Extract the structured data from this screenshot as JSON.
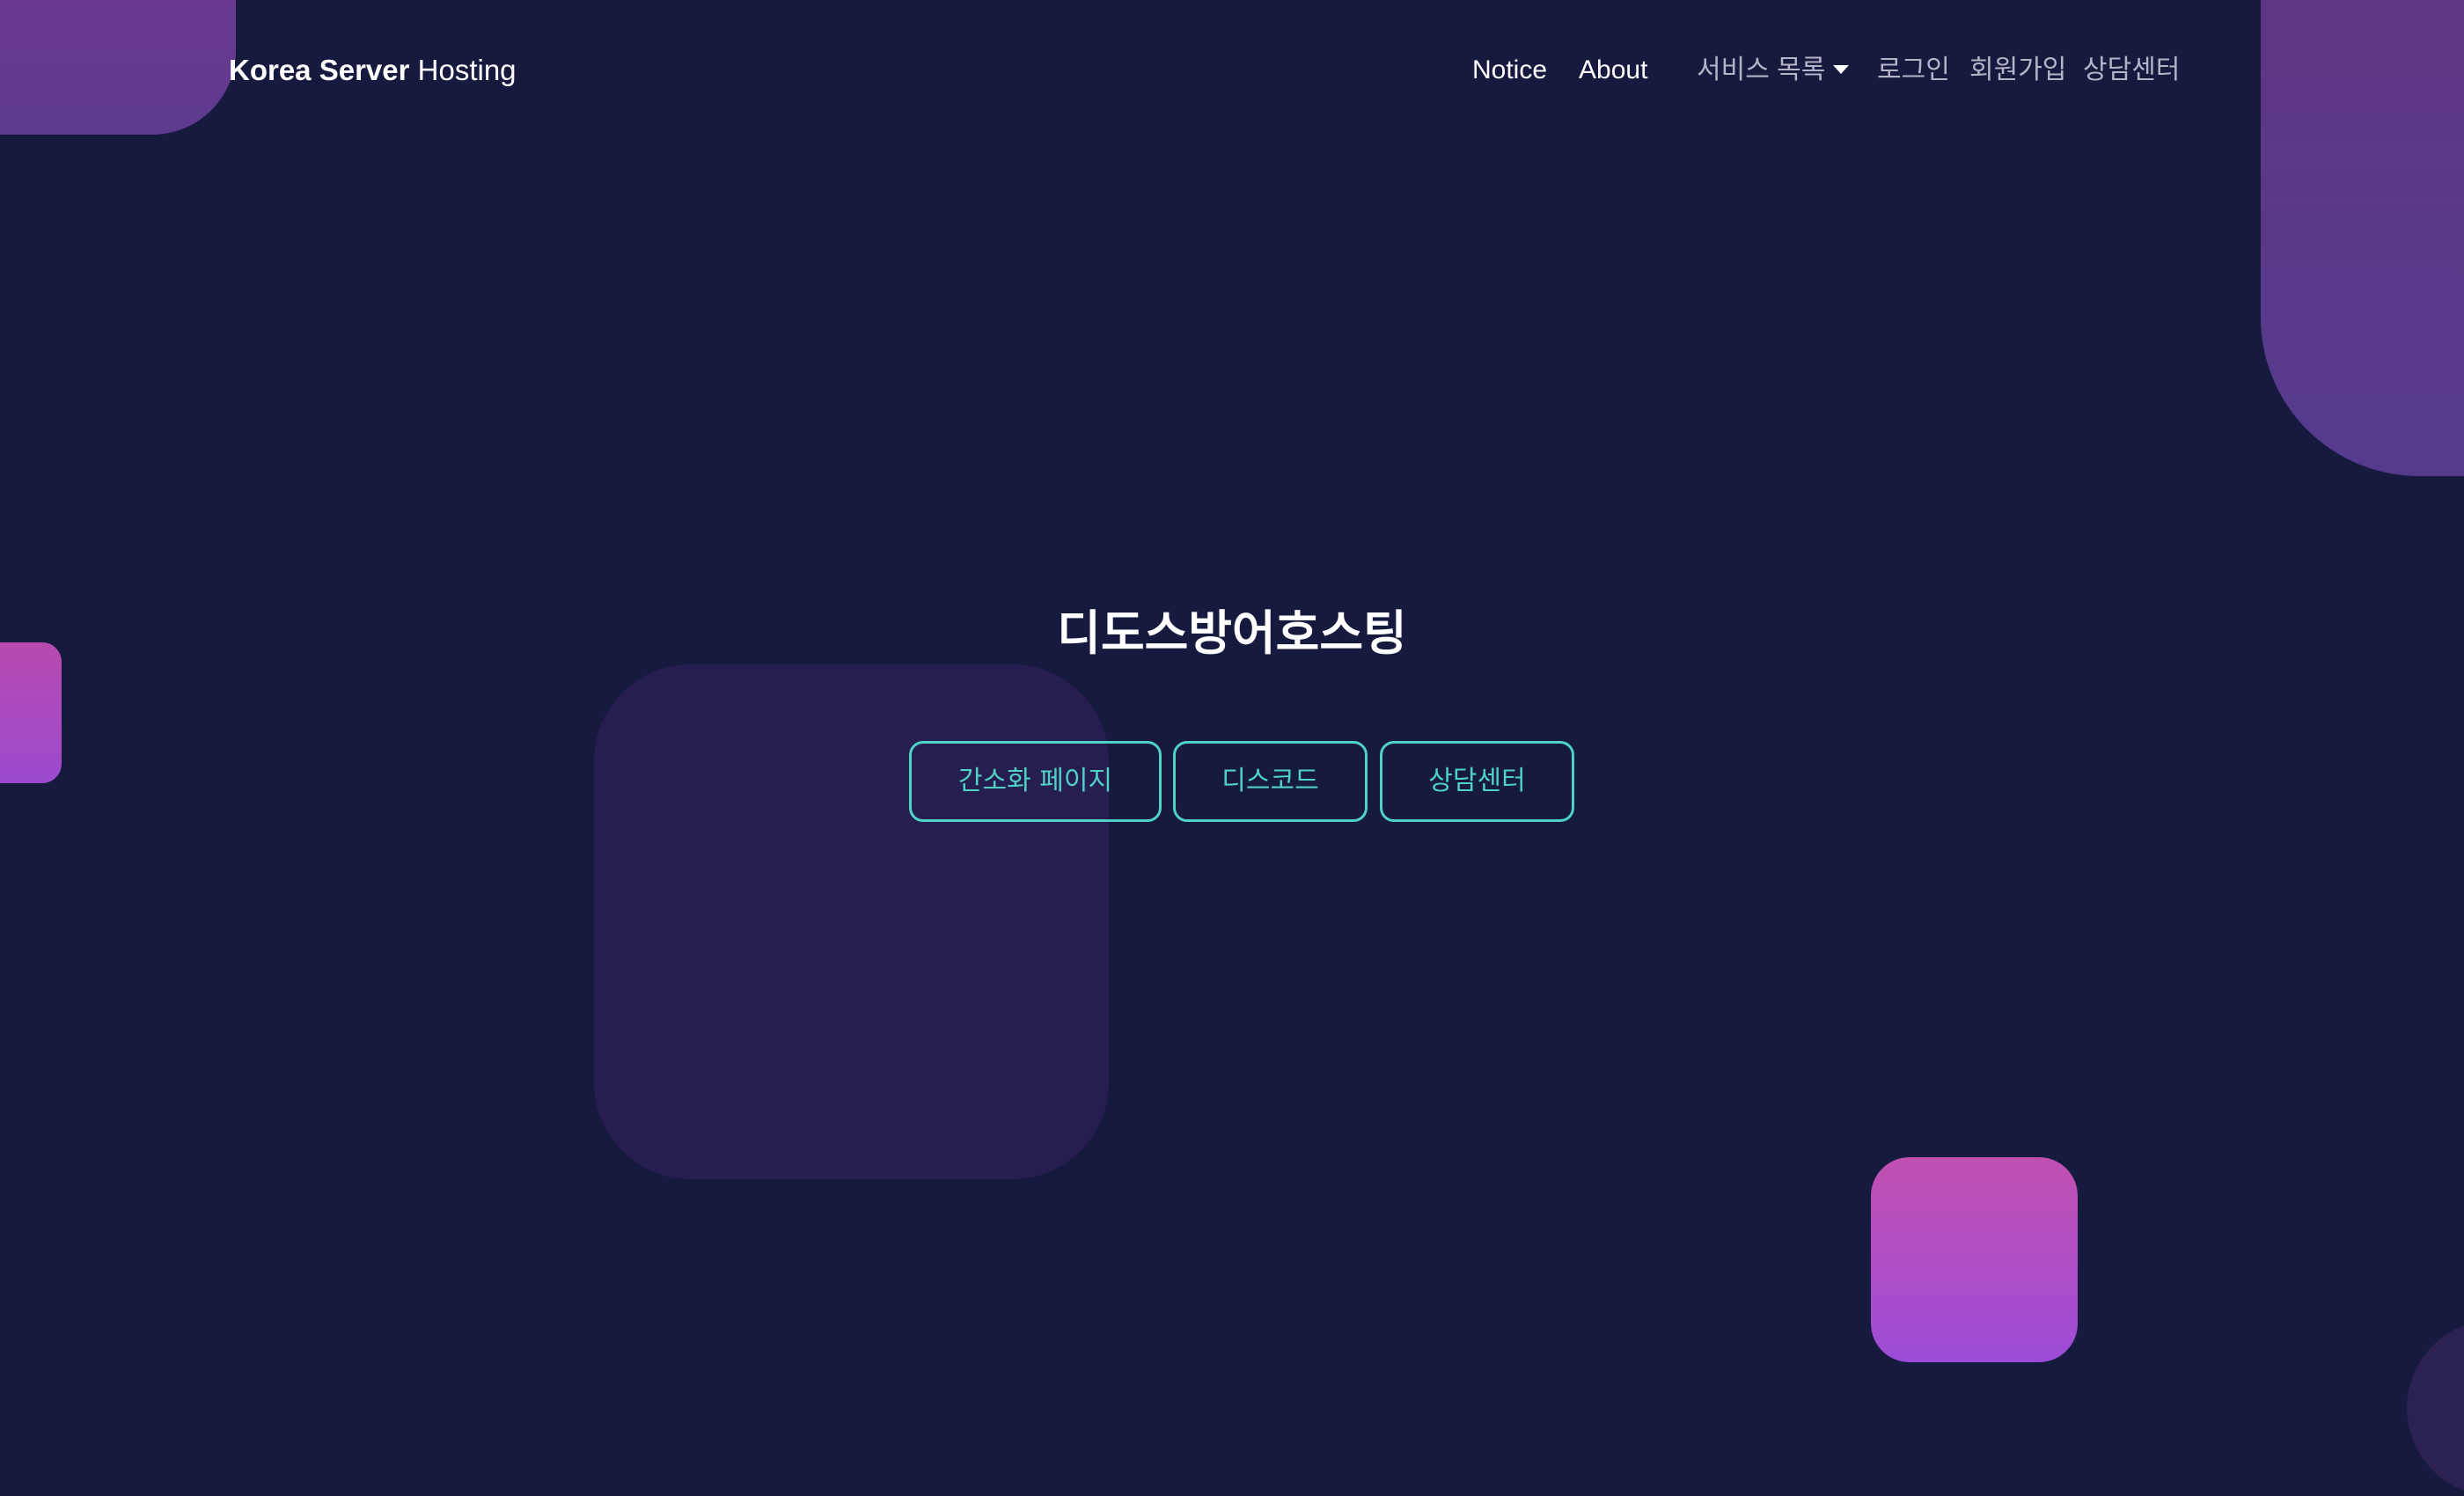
{
  "brand": {
    "strong": "Korea Server",
    "light": "Hosting"
  },
  "nav": {
    "notice": "Notice",
    "about": "About",
    "services": "서비스 목록",
    "login": "로그인",
    "signup": "회원가입",
    "support": "상담센터"
  },
  "hero": {
    "title": "디도스방어호스팅",
    "buttons": {
      "simple": "간소화 페이지",
      "discord": "디스코드",
      "support": "상담센터"
    }
  },
  "colors": {
    "background": "#171a3f",
    "accent": "#4fd1c5",
    "shape_purple": "#6a3a93",
    "shape_pink": "#c150b1"
  }
}
